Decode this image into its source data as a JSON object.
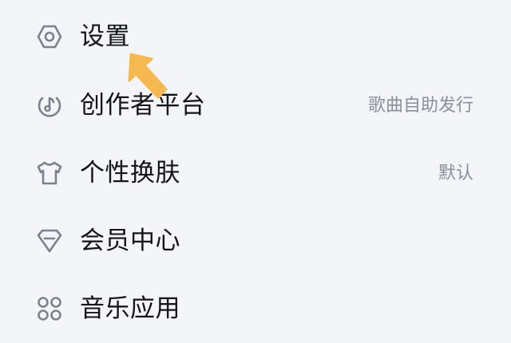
{
  "colors": {
    "background": "#f4f5f8",
    "label_text": "#121419",
    "secondary_text": "#8a8f99",
    "icon_stroke": "#7d828c",
    "annotation_arrow": "#f5b94f"
  },
  "menu": {
    "items": [
      {
        "icon": "settings-hexagon-icon",
        "label": "设置",
        "value": ""
      },
      {
        "icon": "creator-music-icon",
        "label": "创作者平台",
        "value": "歌曲自助发行"
      },
      {
        "icon": "tshirt-icon",
        "label": "个性换肤",
        "value": "默认"
      },
      {
        "icon": "gem-icon",
        "label": "会员中心",
        "value": ""
      },
      {
        "icon": "apps-grid-icon",
        "label": "音乐应用",
        "value": ""
      }
    ]
  },
  "annotation": {
    "icon": "pointer-arrow-icon"
  }
}
